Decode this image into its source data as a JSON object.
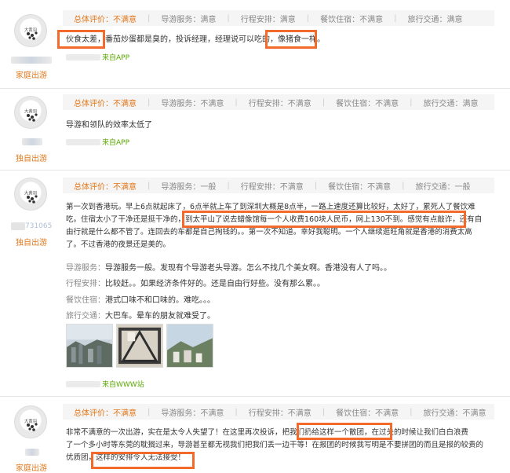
{
  "reviews": [
    {
      "avatar_label": "大黄羽",
      "travel_type": "家庭出游",
      "ratings": {
        "overall": "总体评价：不满意",
        "guide": "导游服务：满意",
        "schedule": "行程安排：满意",
        "dining": "餐饮住宿：不满意",
        "transport": "旅行交通：满意"
      },
      "text": "伙食太差，番茄炒蛋都是臭的，投诉经理，经理说可以吃的，像猪食一样。",
      "source": "来自APP"
    },
    {
      "avatar_label": "大黄羽",
      "travel_type": "独自出游",
      "ratings": {
        "overall": "总体评价：不满意",
        "guide": "导游服务：不满意",
        "schedule": "行程安排：不满意",
        "dining": "餐饮住宿：不满意",
        "transport": "旅行交通：满意"
      },
      "text": "导游和领队的效率太低了",
      "source": "来自APP"
    },
    {
      "avatar_label": "大黄羽",
      "username_partial": "731065",
      "travel_type": "独自出游",
      "ratings": {
        "overall": "总体评价：不满意",
        "guide": "导游服务：一般",
        "schedule": "行程安排：不满意",
        "dining": "餐饮住宿：不满意",
        "transport": "旅行交通：一般"
      },
      "text_lines": [
        "第一次到香港玩。早上6点就起床了，6点半就上车了到深圳大概是8点半，一路上速度还算比较好，太好了，累死人了餐饮难",
        "吃。住宿太小了干净还是挺干净的，到太平山了说去蜡像馆每一个人收费160块人民币，网上130不到。感觉有点敲诈，还有自",
        "由行就是什么都不管了。连回去的车都是自己掏钱的。。第一次不知道。幸好我聪明。一个人继续逛旺角就是香港的消费太高",
        "了。不过香港的夜景还是美的。"
      ],
      "sub": [
        {
          "label": "导游服务：",
          "text": "导游服务一般。发现有个导游老头导游。怎么不找几个美女啊。香港没有人了吗。。"
        },
        {
          "label": "行程安排：",
          "text": "比较赶。。如果经济条件好的。还是自由行好些。没有那么累。。"
        },
        {
          "label": "餐饮住宿：",
          "text": "港式口味不和口味的。难吃。。。"
        },
        {
          "label": "旅行交通：",
          "text": "大巴车。晕车的朋友就难受了。"
        }
      ],
      "source": "来自WWW站"
    },
    {
      "avatar_label": "大黄羽",
      "travel_type": "家庭出游",
      "ratings": {
        "overall": "总体评价：不满意",
        "guide": "导游服务：不满意",
        "schedule": "行程安排：不满意",
        "dining": "餐饮住宿：不满意",
        "transport": "旅行交通：不满意"
      },
      "text_lines": [
        "非常不满意的一次出游，实在是太令人失望了！在这里再次投诉，把我们扔给这样一个散团，在过关的时候让我们白白浪费",
        "了一个多小时等东莞的耽搁过来，导游甚至都无视我们把我们丢一边干等！在报团的时候我写明是不要拼团的而且是报的较贵的",
        "优质团，这样的安排令人无法接受！"
      ]
    }
  ]
}
